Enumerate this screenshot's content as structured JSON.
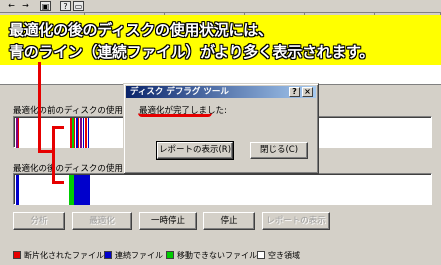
{
  "annotation": {
    "line1": "最適化の後のディスクの使用状況には、",
    "line2": "青のライン（連続ファイル）がより多く表示されます。"
  },
  "toolbar": {
    "icons": [
      "back-arrow-icon",
      "forward-arrow-icon",
      "properties-icon",
      "help-icon",
      "window-icon"
    ]
  },
  "sections": {
    "before_label": "最適化の前のディスクの使用状況",
    "after_label": "最適化の後のディスクの使用状況"
  },
  "buttons": {
    "analyze": "分析",
    "defragment": "最適化",
    "pause": "一時停止",
    "stop": "停止",
    "view_report": "レポートの表示"
  },
  "legend": [
    {
      "label": "断片化されたファイル",
      "color": "#e60000"
    },
    {
      "label": "連続ファイル",
      "color": "#0000cc"
    },
    {
      "label": "移動できないファイル",
      "color": "#00cc00"
    },
    {
      "label": "空き領域",
      "color": "#ffffff"
    }
  ],
  "dialog": {
    "title": "ディスク デフラグ ツール",
    "help_btn": "?",
    "close_btn": "×",
    "message": "最適化が完了しました:",
    "view_report": "レポートの表示(R)",
    "close": "閉じる(C)"
  },
  "colors": {
    "annotation_bg": "#ffff00",
    "pointer": "#e60000",
    "fragmented": "#e60000",
    "contiguous": "#0000cc",
    "unmovable": "#00cc00"
  }
}
